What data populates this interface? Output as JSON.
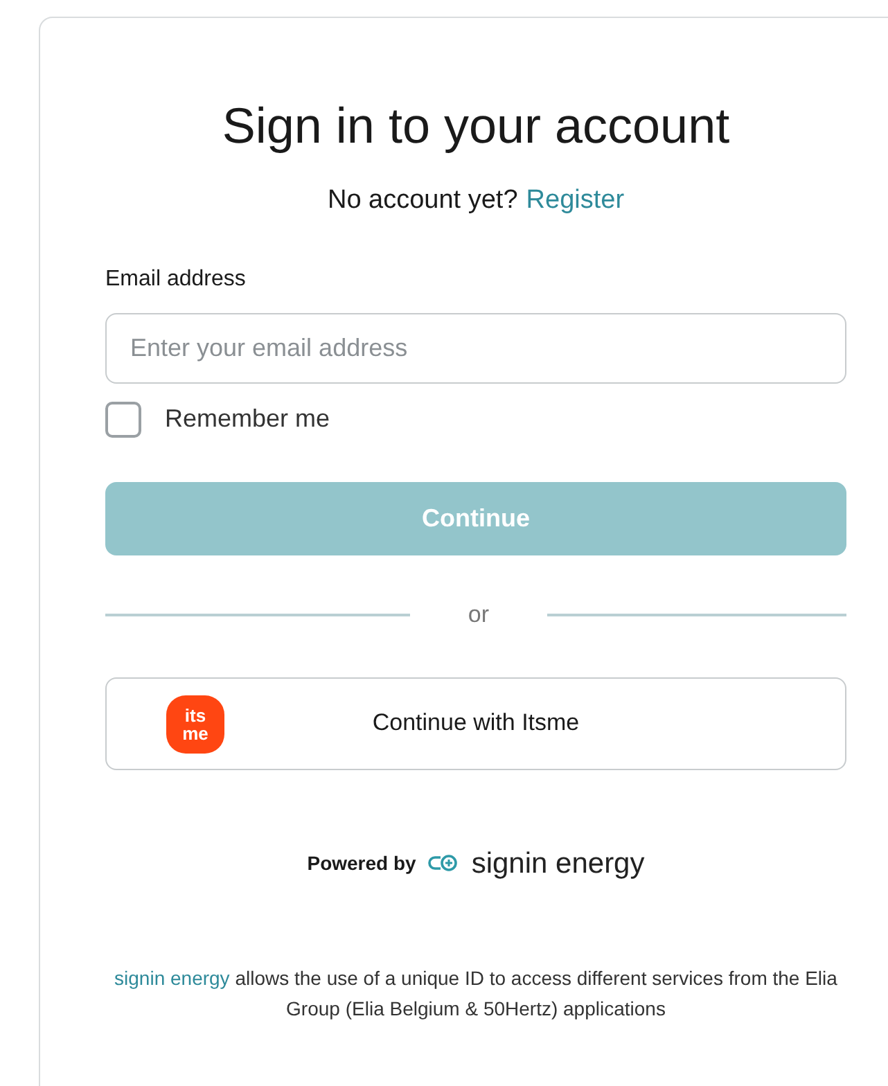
{
  "title": "Sign in to your account",
  "register_prompt": {
    "text": "No account yet?",
    "link": "Register"
  },
  "email": {
    "label": "Email address",
    "placeholder": "Enter your email address"
  },
  "remember_me": {
    "label": "Remember me",
    "checked": false
  },
  "continue_button": {
    "label": "Continue",
    "disabled": true
  },
  "divider": "or",
  "itsme_button": {
    "label": "Continue with Itsme",
    "logo_text": [
      "its",
      "me"
    ]
  },
  "powered_by": {
    "text": "Powered by",
    "brand": "signin energy"
  },
  "footer": {
    "link": "signin energy",
    "text": "allows the use of a unique ID to access different services from the Elia Group (Elia Belgium & 50Hertz) applications"
  }
}
